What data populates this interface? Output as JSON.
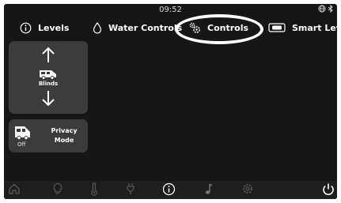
{
  "status": {
    "time": "09:52"
  },
  "tabs": [
    {
      "label": "Levels",
      "icon": "info-circle-icon"
    },
    {
      "label": "Water Controls",
      "icon": "water-drop-icon"
    },
    {
      "label": "Controls",
      "icon": "gears-icon",
      "active": true
    },
    {
      "label": "Smart Level",
      "icon": "level-bubble-icon"
    }
  ],
  "blinds": {
    "label": "Blinds"
  },
  "privacy": {
    "state": "Off",
    "label_line1": "Privacy",
    "label_line2": "Mode"
  },
  "bottom_nav": [
    {
      "icon": "home-icon"
    },
    {
      "icon": "lightbulb-icon"
    },
    {
      "icon": "thermometer-icon"
    },
    {
      "icon": "power-plug-icon"
    },
    {
      "icon": "info-icon"
    },
    {
      "icon": "music-note-icon"
    },
    {
      "icon": "settings-gear-icon"
    },
    {
      "icon": "power-icon"
    }
  ],
  "colors": {
    "screen_bg": "#161616",
    "card_bg": "#3c3c3c",
    "highlight": "#ffffff"
  }
}
